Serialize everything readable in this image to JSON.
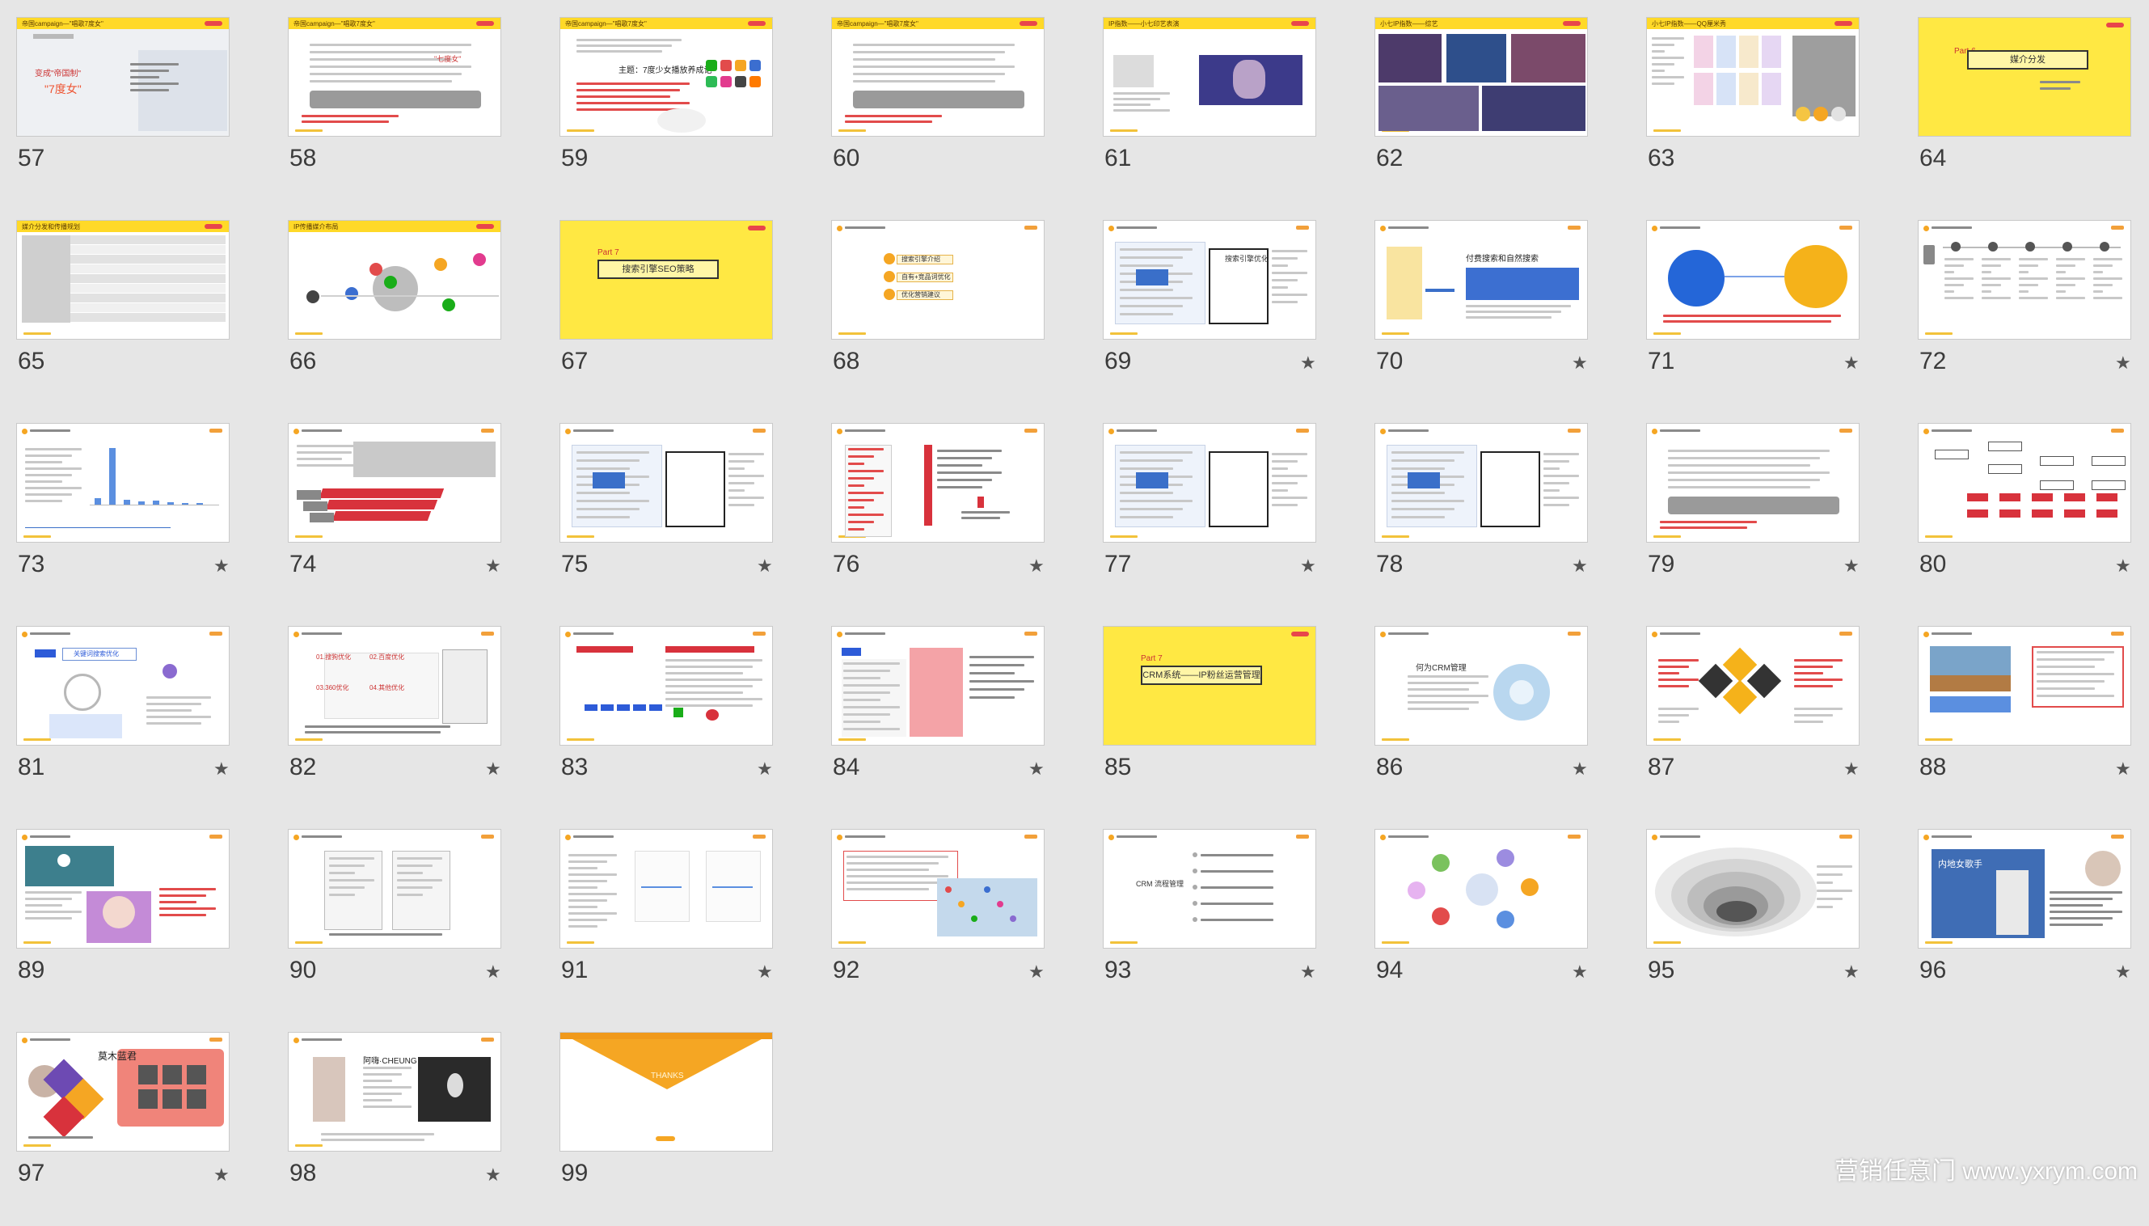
{
  "watermark": "营销任意门 www.yxrym.com",
  "slides": [
    {
      "number": "57",
      "starred": false,
      "style": "cover",
      "header": "帝国campaign—\"唱歌7度女\"",
      "lines": [
        "变成\"帝国制\"",
        "\"7度女\""
      ]
    },
    {
      "number": "58",
      "starred": false,
      "style": "text",
      "header": "帝国campaign—\"唱歌7度女\"",
      "lines": [
        "\"七度女\""
      ]
    },
    {
      "number": "59",
      "starred": false,
      "style": "apps",
      "header": "帝国campaign—\"唱歌7度女\"",
      "lines": [
        "主题：7度少女播放养成记"
      ]
    },
    {
      "number": "60",
      "starred": false,
      "style": "text",
      "header": "帝国campaign—\"唱歌7度女\"",
      "lines": []
    },
    {
      "number": "61",
      "starred": false,
      "style": "photo-right",
      "header": "IP指数——小七印艺表演",
      "lines": []
    },
    {
      "number": "62",
      "starred": false,
      "style": "collage",
      "header": "小七IP指数——综艺",
      "lines": []
    },
    {
      "number": "63",
      "starred": false,
      "style": "grid-img",
      "header": "小七IP指数——QQ厘米秀",
      "lines": []
    },
    {
      "number": "64",
      "starred": false,
      "style": "part",
      "header": "",
      "part": "Part 6",
      "title": "媒介分发",
      "lines": []
    },
    {
      "number": "65",
      "starred": false,
      "style": "table",
      "header": "媒介分发和传播规划",
      "lines": []
    },
    {
      "number": "66",
      "starred": false,
      "style": "bubbles",
      "header": "IP传播媒介布局",
      "lines": []
    },
    {
      "number": "67",
      "starred": false,
      "style": "part",
      "header": "",
      "part": "Part 7",
      "title": "搜索引擎SEO策略",
      "lines": []
    },
    {
      "number": "68",
      "starred": false,
      "style": "list",
      "header": "",
      "lines": [
        "搜索引擎介绍",
        "自有+竞品词优化",
        "优化营销建议"
      ]
    },
    {
      "number": "69",
      "starred": true,
      "style": "screen",
      "header": "",
      "lines": [
        "搜索引擎优化"
      ]
    },
    {
      "number": "70",
      "starred": true,
      "style": "screen-blue",
      "header": "",
      "lines": [
        "付费搜索和自然搜索"
      ]
    },
    {
      "number": "71",
      "starred": true,
      "style": "circles",
      "header": "",
      "lines": []
    },
    {
      "number": "72",
      "starred": true,
      "style": "timeline",
      "header": "",
      "lines": []
    },
    {
      "number": "73",
      "starred": true,
      "style": "barchart",
      "header": "",
      "lines": []
    },
    {
      "number": "74",
      "starred": true,
      "style": "arrows",
      "header": "",
      "lines": []
    },
    {
      "number": "75",
      "starred": true,
      "style": "screen",
      "header": "",
      "lines": []
    },
    {
      "number": "76",
      "starred": true,
      "style": "redlist",
      "header": "",
      "lines": []
    },
    {
      "number": "77",
      "starred": true,
      "style": "screen",
      "header": "",
      "lines": []
    },
    {
      "number": "78",
      "starred": true,
      "style": "screen",
      "header": "",
      "lines": []
    },
    {
      "number": "79",
      "starred": true,
      "style": "text",
      "header": "",
      "lines": []
    },
    {
      "number": "80",
      "starred": true,
      "style": "flow",
      "header": "",
      "lines": []
    },
    {
      "number": "81",
      "starred": true,
      "style": "search",
      "header": "",
      "lines": [
        "关键词搜索优化"
      ]
    },
    {
      "number": "82",
      "starred": true,
      "style": "quad",
      "header": "",
      "lines": [
        "01.搜狗优化",
        "02.百度优化",
        "03.360优化",
        "04.其他优化"
      ]
    },
    {
      "number": "83",
      "starred": true,
      "style": "logos",
      "header": "",
      "lines": []
    },
    {
      "number": "84",
      "starred": true,
      "style": "screen-red",
      "header": "",
      "lines": []
    },
    {
      "number": "85",
      "starred": false,
      "style": "part",
      "header": "",
      "part": "Part 7",
      "title": "CRM系统——IP粉丝运营管理",
      "lines": []
    },
    {
      "number": "86",
      "starred": true,
      "style": "crm",
      "header": "",
      "lines": [
        "何为CRM管理"
      ]
    },
    {
      "number": "87",
      "starred": true,
      "style": "diamonds",
      "header": "",
      "lines": []
    },
    {
      "number": "88",
      "starred": true,
      "style": "photo-top",
      "header": "",
      "lines": []
    },
    {
      "number": "89",
      "starred": false,
      "style": "anime",
      "header": "",
      "lines": []
    },
    {
      "number": "90",
      "starred": true,
      "style": "phones",
      "header": "",
      "lines": []
    },
    {
      "number": "91",
      "starred": true,
      "style": "charts",
      "header": "",
      "lines": []
    },
    {
      "number": "92",
      "starred": true,
      "style": "map",
      "header": "",
      "lines": []
    },
    {
      "number": "93",
      "starred": true,
      "style": "crm-list",
      "header": "",
      "lines": [
        "CRM 流程管理"
      ]
    },
    {
      "number": "94",
      "starred": true,
      "style": "network",
      "header": "",
      "lines": []
    },
    {
      "number": "95",
      "starred": true,
      "style": "funnel",
      "header": "",
      "lines": []
    },
    {
      "number": "96",
      "starred": true,
      "style": "singer",
      "header": "",
      "lines": [
        "内地女歌手"
      ]
    },
    {
      "number": "97",
      "starred": true,
      "style": "profile",
      "header": "",
      "lines": [
        "莫木蓝君"
      ]
    },
    {
      "number": "98",
      "starred": true,
      "style": "profile-dark",
      "header": "",
      "lines": [
        "阿嗨·CHEUNG"
      ]
    },
    {
      "number": "99",
      "starred": false,
      "style": "thanks",
      "header": "",
      "lines": [
        "THANKS"
      ]
    }
  ],
  "icons": {
    "star": "star-icon"
  }
}
